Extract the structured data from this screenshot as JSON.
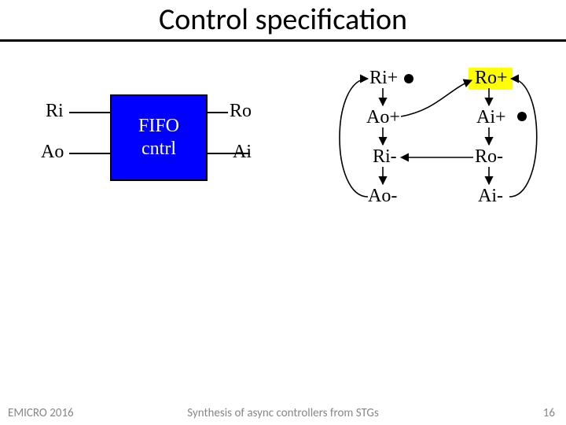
{
  "slide": {
    "title": "Control specification"
  },
  "block": {
    "line1": "FIFO",
    "line2": "cntrl",
    "ports": {
      "ri": "Ri",
      "ao": "Ao",
      "ro": "Ro",
      "ai": "Ai"
    }
  },
  "stg": {
    "left": {
      "t0": "Ri+",
      "t1": "Ao+",
      "t2": "Ri-",
      "t3": "Ao-"
    },
    "right": {
      "t0": "Ro+",
      "t1": "Ai+",
      "t2": "Ro-",
      "t3": "Ai-"
    }
  },
  "footer": {
    "conference": "EMICRO 2016",
    "talk": "Synthesis of async controllers from STGs",
    "page": "16"
  }
}
